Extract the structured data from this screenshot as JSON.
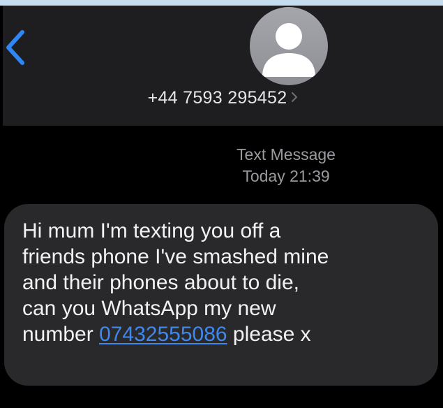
{
  "header": {
    "back_icon": "chevron-left-icon",
    "avatar_icon": "person-silhouette-icon",
    "contact_number": "+44 7593 295452",
    "contact_chevron_icon": "chevron-right-icon"
  },
  "thread": {
    "message_type": "Text Message",
    "timestamp": "Today 21:39"
  },
  "message": {
    "line1": "Hi mum I'm texting you off a",
    "line2": "friends phone I've smashed mine",
    "line3": "and their phones about to die,",
    "line4": "can you WhatsApp my new",
    "line5_prefix": "number ",
    "phone_link": "07432555086",
    "line5_suffix": " please x"
  },
  "colors": {
    "header_bg": "#1e1e20",
    "bubble_bg": "#29292b",
    "link": "#3f88ee",
    "back_chevron": "#2f86f4",
    "meta_text": "#9a9a9f"
  }
}
